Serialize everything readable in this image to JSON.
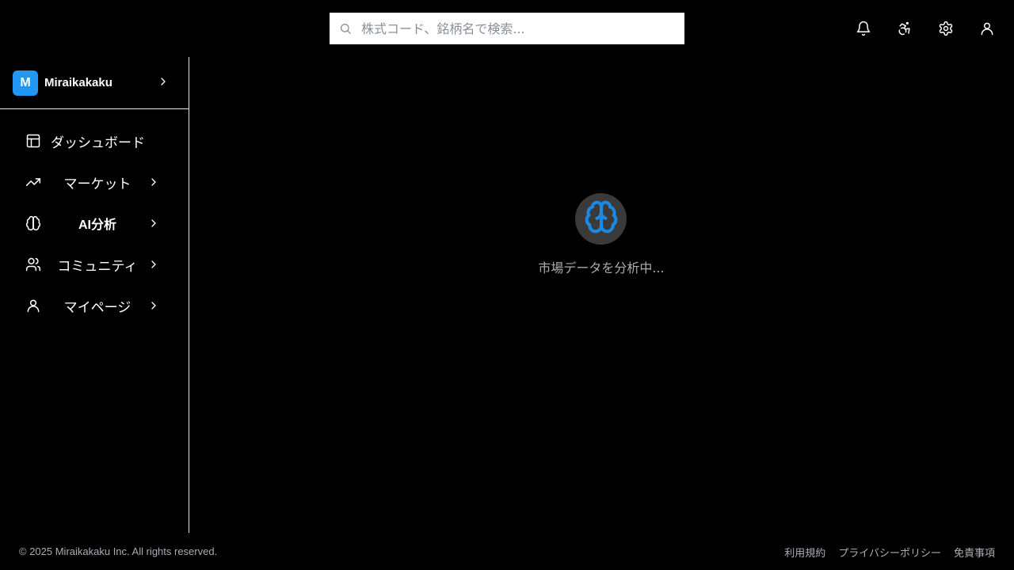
{
  "search": {
    "placeholder": "株式コード、銘柄名で検索...",
    "icon": "search-icon"
  },
  "top_icons": [
    {
      "name": "bell-icon"
    },
    {
      "name": "accessibility-icon"
    },
    {
      "name": "gear-icon"
    },
    {
      "name": "user-icon"
    }
  ],
  "sidebar": {
    "brand": {
      "logo_letter": "M",
      "name": "Miraikakaku"
    },
    "items": [
      {
        "label": "ダッシュボード",
        "icon": "layout-icon",
        "has_submenu": false
      },
      {
        "label": "マーケット",
        "icon": "trending-up-icon",
        "has_submenu": true
      },
      {
        "label": "AI分析",
        "icon": "brain-icon",
        "has_submenu": true
      },
      {
        "label": "コミュニティ",
        "icon": "users-icon",
        "has_submenu": true
      },
      {
        "label": "マイページ",
        "icon": "user-icon",
        "has_submenu": true
      }
    ]
  },
  "main": {
    "loader_icon": "brain-icon",
    "loading_text": "市場データを分析中..."
  },
  "footer": {
    "copyright": "© 2025 Miraikakaku Inc. All rights reserved.",
    "links": [
      "利用規約",
      "プライバシーポリシー",
      "免責事項"
    ]
  },
  "colors": {
    "background": "#000000",
    "brand_accent": "#2196f3",
    "muted_text": "#a9acb3",
    "divider": "#e6e6e6"
  }
}
